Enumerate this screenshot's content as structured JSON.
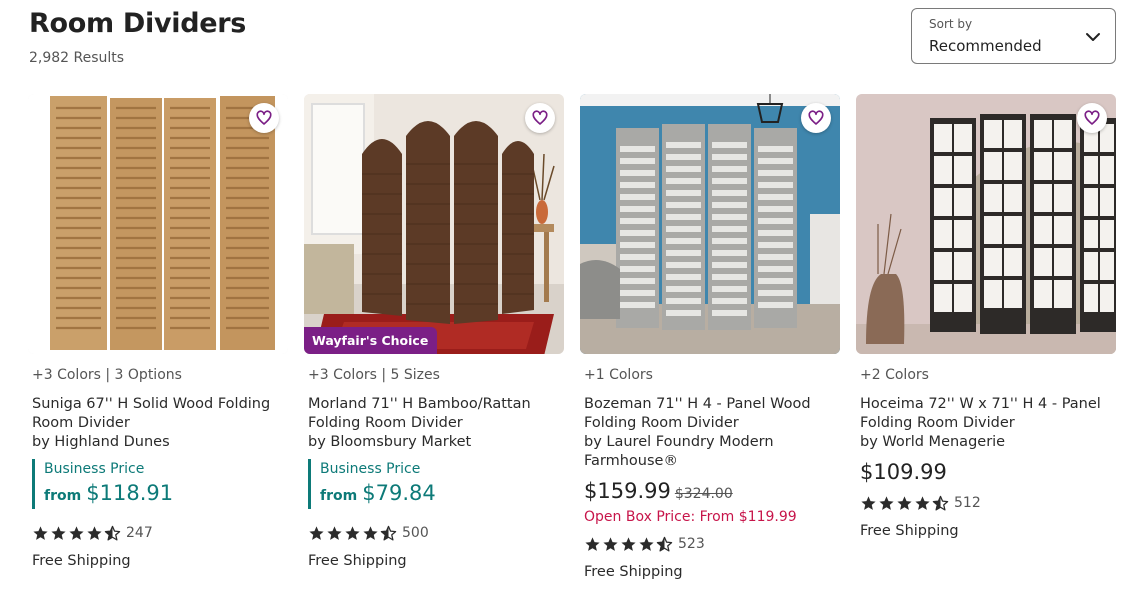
{
  "page": {
    "title": "Room Dividers",
    "results": "2,982 Results"
  },
  "sort": {
    "label": "Sort by",
    "value": "Recommended",
    "icon": "chevron-down-icon"
  },
  "colors": {
    "business": "#0d7a78",
    "open_box": "#c7154a",
    "badge": "#7b1f86",
    "heart": "#7b1f86"
  },
  "products": [
    {
      "options": "+3 Colors | 3 Options",
      "title_line1": "Suniga 67'' H Solid Wood Folding",
      "title_line2": "Room Divider",
      "brand": "by Highland Dunes",
      "business_label": "Business Price",
      "business_from": "from",
      "business_price": "$118.91",
      "rating": 4.5,
      "rating_count": "247",
      "shipping": "Free Shipping"
    },
    {
      "options": "+3 Colors | 5 Sizes",
      "badge": "Wayfair's Choice",
      "title_line1": "Morland 71'' H Bamboo/Rattan",
      "title_line2": "Folding Room Divider",
      "brand": "by Bloomsbury Market",
      "business_label": "Business Price",
      "business_from": "from",
      "business_price": "$79.84",
      "rating": 4.5,
      "rating_count": "500",
      "shipping": "Free Shipping"
    },
    {
      "options": "+1 Colors",
      "title_line1": "Bozeman 71'' H 4 - Panel Wood",
      "title_line2": "Folding Room Divider",
      "brand": "by Laurel Foundry Modern",
      "brand_line2": "Farmhouse®",
      "price": "$159.99",
      "old_price": "$324.00",
      "open_box": "Open Box Price: From $119.99",
      "rating": 4.5,
      "rating_count": "523",
      "shipping": "Free Shipping"
    },
    {
      "options": "+2 Colors",
      "title_line1": "Hoceima 72'' W x 71'' H 4 - Panel",
      "title_line2": "Folding Room Divider",
      "brand": "by World Menagerie",
      "price": "$109.99",
      "rating": 4.5,
      "rating_count": "512",
      "shipping": "Free Shipping"
    }
  ]
}
